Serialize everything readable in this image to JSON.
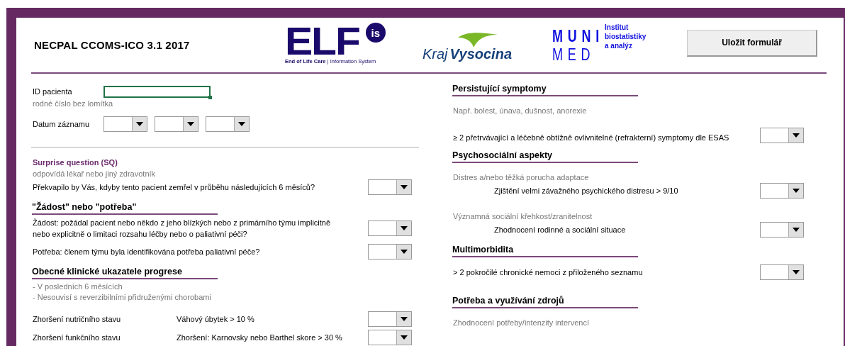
{
  "header": {
    "title": "NECPAL CCOMS-ICO 3.1 2017",
    "elf_logo": {
      "letters": "ELF",
      "badge": "is",
      "tagline_bold": "End of Life Care",
      "tagline": "| Information System"
    },
    "region_logo": {
      "prefix": "Kraj",
      "name": "Vysocina"
    },
    "muni_logo": {
      "top": "MUNI",
      "bottom": "MED",
      "institute": [
        "Institut",
        "biostatistiky",
        "a analýz"
      ]
    },
    "save_button": "Uložit formulář"
  },
  "patient": {
    "id_label": "ID pacienta",
    "id_hint": "rodné číslo bez lomítka",
    "id_focused": true,
    "date_label": "Datum záznamu",
    "date_dropdowns": [
      {
        "kind": "dropdown"
      },
      {
        "kind": "dropdown"
      },
      {
        "kind": "dropdown"
      }
    ]
  },
  "left_sections": [
    {
      "title": "Surprise question (SQ)",
      "kind": "accent",
      "items": [
        {
          "kind": "note",
          "text": "odpovídá lékař nebo jiný zdravotník"
        },
        {
          "kind": "question",
          "text": "Překvapilo by Vás, kdyby tento pacient zemřel v průběhu následujících 6 měsíců?"
        }
      ]
    },
    {
      "title": "\"Žádost\" nebo \"potřeba\"",
      "kind": "heading",
      "items": [
        {
          "kind": "question",
          "text": "Žádost: požádal pacient nebo někdo z jeho blízkých nebo z primárního týmu implicitně nebo explicitně o limitaci rozsahu léčby nebo o paliativní péči?"
        },
        {
          "kind": "question",
          "text": "Potřeba: členem týmu byla identifikována potřeba paliativní péče?"
        }
      ]
    },
    {
      "title": "Obecné klinické ukazatele progrese",
      "kind": "heading",
      "items": [
        {
          "kind": "note",
          "text": "- V posledních 6 měsících"
        },
        {
          "kind": "note",
          "text": "- Nesouvisí s reverzibilními přidruženými chorobami"
        },
        {
          "kind": "indicator",
          "label": "Zhoršení nutričního stavu",
          "criterion": "Váhový úbytek > 10 %"
        },
        {
          "kind": "indicator",
          "label": "Zhoršení funkčního stavu",
          "criterion": "Zhoršení: Karnovsky nebo Barthel skore > 30 %"
        }
      ]
    }
  ],
  "right_sections": [
    {
      "title": "Persistující symptomy",
      "kind": "heading",
      "items": [
        {
          "kind": "note",
          "text": "Např. bolest, únava, dušnost, anorexie"
        },
        {
          "kind": "question",
          "text": "≥ 2 přetrvávající a léčebně obtížně ovlivnitelné (refrakterní) symptomy dle ESAS"
        }
      ]
    },
    {
      "title": "Psychosociální aspekty",
      "kind": "heading",
      "items": [
        {
          "kind": "note",
          "text": "Distres a/nebo těžká porucha adaptace"
        },
        {
          "kind": "detail",
          "text": "Zjištění velmi závažného psychického distresu >  9/10"
        },
        {
          "kind": "note",
          "text": "Významná sociální křehkost/zranitelnost"
        },
        {
          "kind": "detail",
          "text": "Zhodnocení rodinné a sociální situace"
        }
      ]
    },
    {
      "title": "Multimorbidita",
      "kind": "heading",
      "items": [
        {
          "kind": "question",
          "text": "> 2 pokročilé chronické nemoci z přiloženého seznamu"
        }
      ]
    },
    {
      "title": "Potřeba a využívání zdrojů",
      "kind": "heading",
      "items": [
        {
          "kind": "note",
          "text": "Zhodnocení potřeby/intenzity intervencí"
        }
      ]
    }
  ]
}
